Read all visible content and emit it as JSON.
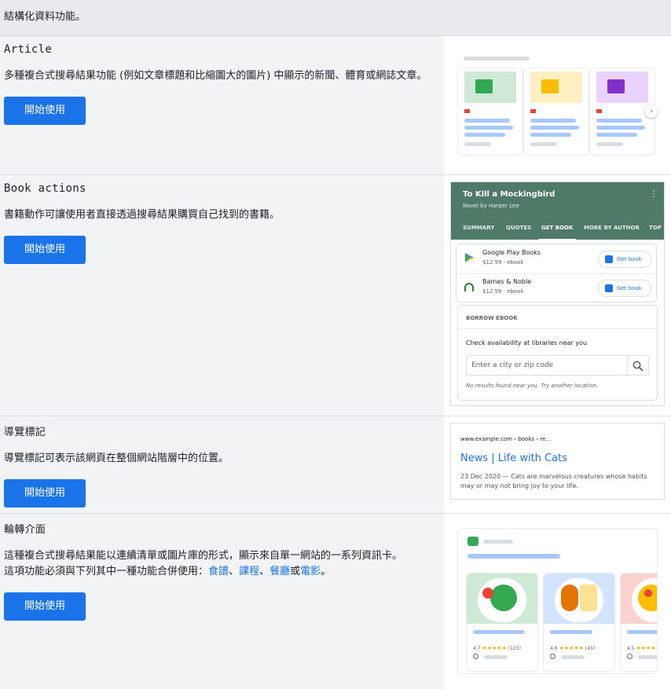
{
  "header": {
    "text": "結構化資料功能。"
  },
  "sections": [
    {
      "title": "Article",
      "desc": "多種複合式搜尋結果功能 (例如文章標題和比縮圖大的圖片) 中顯示的新聞、體育或網誌文章。",
      "button": "開始使用"
    },
    {
      "title": "Book actions",
      "desc": "書籍動作可讓使用者直接透過搜尋結果購買自己找到的書籍。",
      "button": "開始使用"
    },
    {
      "title": "導覽標記",
      "desc": "導覽標記可表示該網頁在整個網站階層中的位置。",
      "button": "開始使用"
    },
    {
      "title": "輪轉介面",
      "desc_line1": "這種複合式搜尋結果能以連續清單或圖片庫的形式，顯示來自單一網站的一系列資訊卡。",
      "desc_line2_prefix": "這項功能必須與下列其中一種功能合併使用：",
      "links": [
        "食譜",
        "課程",
        "餐廳",
        "電影"
      ],
      "sep1": "、",
      "sep2": "、",
      "sep3": "或",
      "end": "。",
      "button": "開始使用"
    }
  ],
  "book": {
    "title": "To Kill a Mockingbird",
    "subtitle": "Novel by Harper Lee",
    "tabs": [
      "SUMMARY",
      "QUOTES",
      "GET BOOK",
      "MORE BY AUTHOR",
      "TOP"
    ],
    "active_tab": "GET BOOK",
    "stores": [
      {
        "name": "Google Play Books",
        "price": "$12.99 · ebook",
        "action": "Get book"
      },
      {
        "name": "Barnes & Noble",
        "price": "$12.99 · ebook",
        "action": "Get book"
      }
    ],
    "borrow_title": "BORROW EBOOK",
    "borrow_text": "Check availability at libraries near you",
    "zip_placeholder": "Enter a city or zip code",
    "no_results": "No results found near you. Try another location."
  },
  "breadcrumb_example": {
    "url": "www.example.com › books › re...",
    "title": "News | Life with Cats",
    "snippet": "23 Dec 2020 — Cats are marvelous creatures whose habits may or may not bring joy to your life."
  },
  "carousel": {
    "cards": [
      {
        "rating": "4.7",
        "count": "(123)"
      },
      {
        "rating": "4.6",
        "count": "(45)"
      },
      {
        "rating": "4.5",
        "count": ""
      }
    ]
  },
  "colors": {
    "accent": "#1a73e8",
    "book_header": "#4f7a68"
  }
}
